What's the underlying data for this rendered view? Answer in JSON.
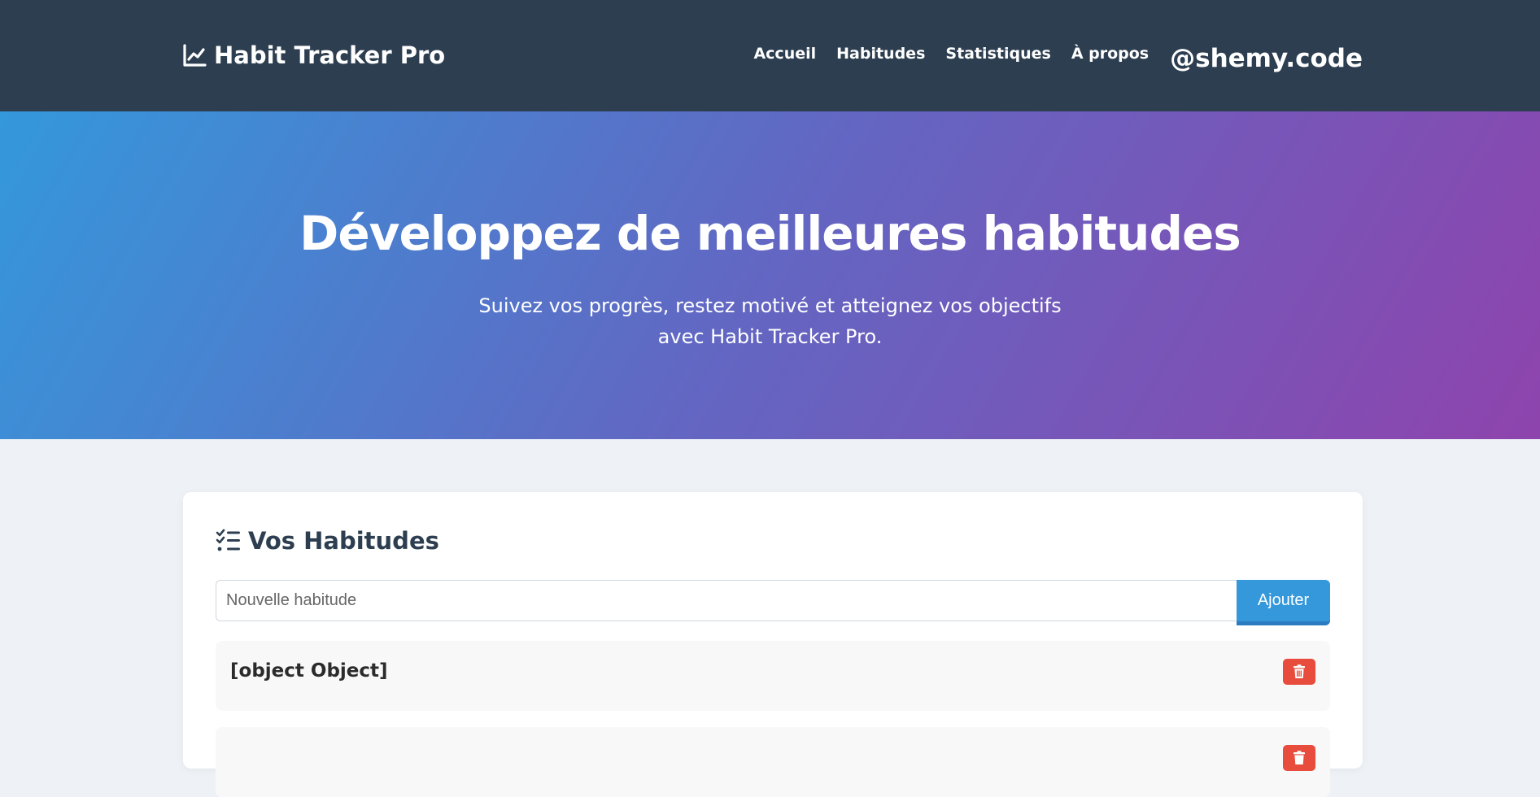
{
  "navbar": {
    "brand": "Habit Tracker Pro",
    "brand_icon": "chart-line-icon",
    "links": [
      "Accueil",
      "Habitudes",
      "Statistiques",
      "À propos"
    ],
    "handle": "@shemy.code"
  },
  "hero": {
    "title": "Développez de meilleures habitudes",
    "subtitle_line1": "Suivez vos progrès, restez motivé et atteignez vos objectifs",
    "subtitle_line2": "avec Habit Tracker Pro."
  },
  "habits_card": {
    "title": "Vos Habitudes",
    "title_icon": "list-check-icon",
    "input_placeholder": "Nouvelle habitude",
    "input_value": "",
    "add_label": "Ajouter",
    "items": [
      {
        "name": "[object Object]"
      },
      {
        "name": ""
      }
    ]
  },
  "colors": {
    "navbar": "#2c3e50",
    "hero_start": "#3498db",
    "hero_end": "#8e44ad",
    "accent": "#3498db",
    "danger": "#e74c3c",
    "page_bg": "#eef2f6"
  }
}
